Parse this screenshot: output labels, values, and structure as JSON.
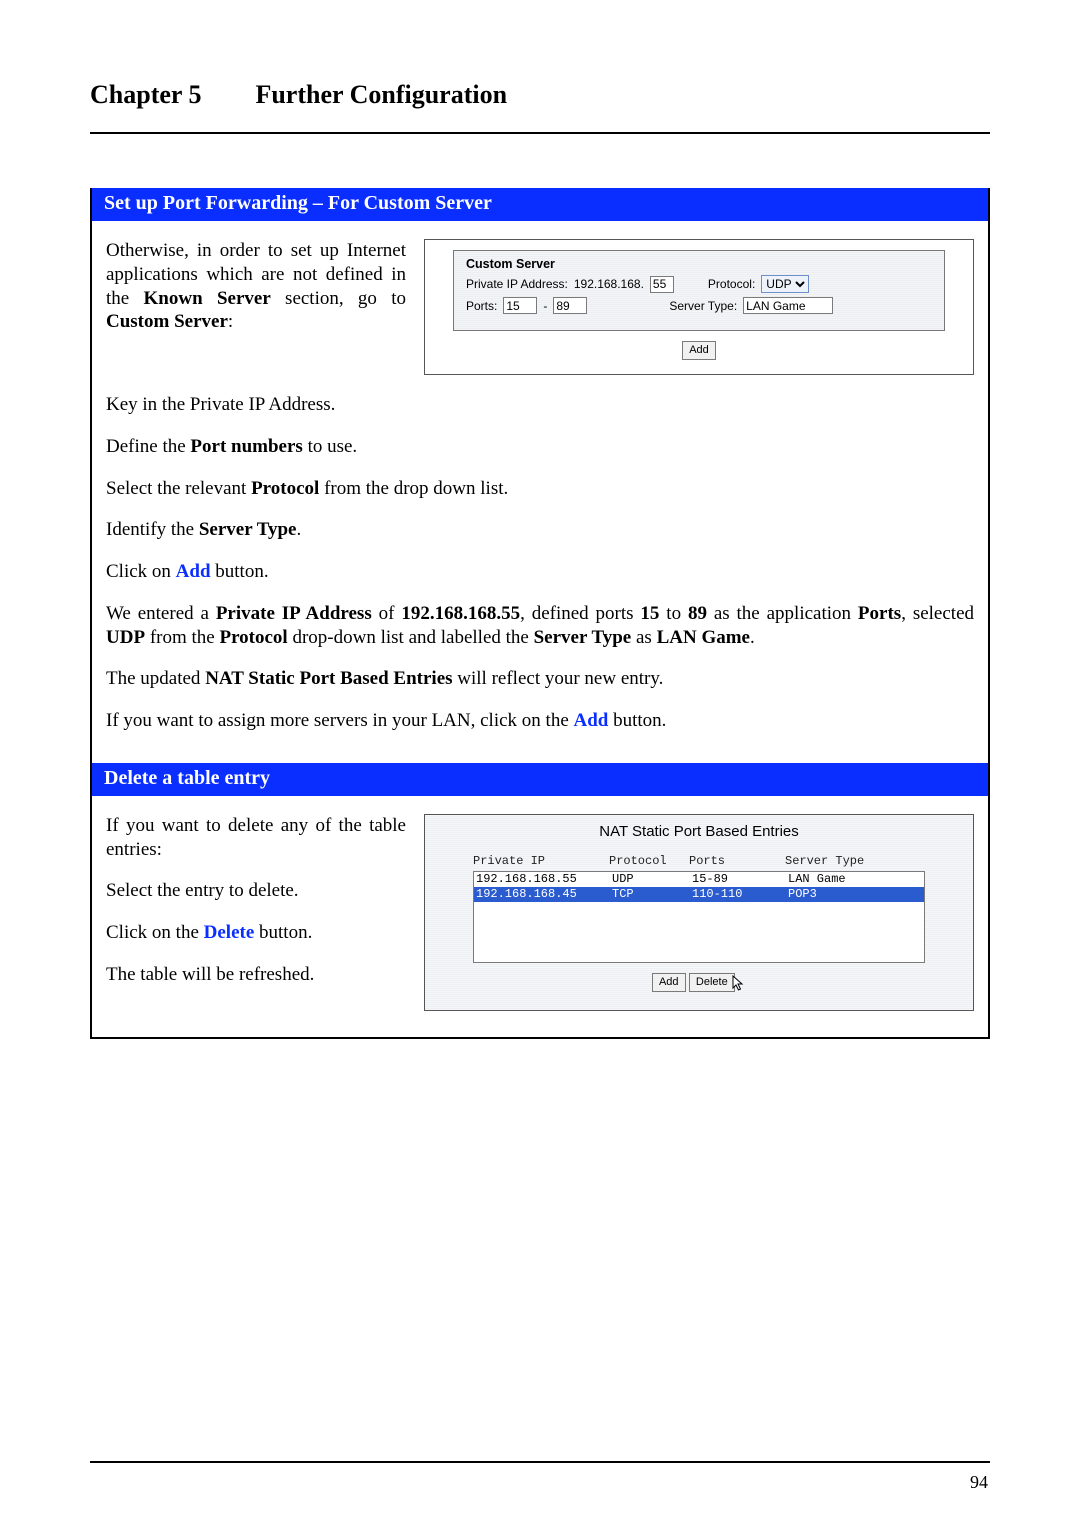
{
  "chapter": {
    "number": "Chapter 5",
    "title": "Further Configuration"
  },
  "page_number": "94",
  "section1": {
    "heading": "Set up Port Forwarding – For Custom Server",
    "p1_a": "Otherwise, in order to set up Internet applications which are not defined in the ",
    "p1_known": "Known Server",
    "p1_b": " section, go to ",
    "p1_custom": "Custom Server",
    "p1_c": ":",
    "p2": "Key in the Private IP Address.",
    "p3_a": "Define the ",
    "p3_b": "Port numbers",
    "p3_c": " to use.",
    "p4_a": "Select the relevant ",
    "p4_b": "Protocol",
    "p4_c": " from the drop down list.",
    "p5_a": "Identify the ",
    "p5_b": "Server Type",
    "p5_c": ".",
    "p6_a": "Click on ",
    "p6_add": "Add",
    "p6_b": " button.",
    "p7_full": "We entered a Private IP Address of 192.168.168.55, defined ports 15 to 89 as the application Ports, selected UDP from the Protocol drop-down list and labelled the Server Type as LAN Game.",
    "p8_a": "The updated ",
    "p8_b": "NAT Static Port Based Entries",
    "p8_c": " will reflect your new entry.",
    "p9_a": "If you want to assign more servers in your LAN, click on the ",
    "p9_add": "Add",
    "p9_b": " button."
  },
  "fig1": {
    "title": "Custom Server",
    "ip_label": "Private IP Address:",
    "ip_prefix": "192.168.168.",
    "ip_last": "55",
    "protocol_label": "Protocol:",
    "protocol_value": "UDP",
    "ports_label": "Ports:",
    "port_from": "15",
    "port_dash": "-",
    "port_to": "89",
    "server_type_label": "Server Type:",
    "server_type_value": "LAN Game",
    "add_btn": "Add"
  },
  "section2": {
    "heading": "Delete a table entry",
    "p1": "If you want to delete any of the table entries:",
    "p2": "Select the entry to delete.",
    "p3_a": "Click on the ",
    "p3_del": "Delete",
    "p3_b": " button.",
    "p4": "The table will be refreshed."
  },
  "fig2": {
    "title": "NAT Static Port Based Entries",
    "headers": {
      "ip": "Private IP",
      "protocol": "Protocol",
      "ports": "Ports",
      "type": "Server Type"
    },
    "rows": [
      {
        "ip": "192.168.168.55",
        "protocol": "UDP",
        "ports": "15-89",
        "type": "LAN Game",
        "selected": false
      },
      {
        "ip": "192.168.168.45",
        "protocol": "TCP",
        "ports": "110-110",
        "type": "POP3",
        "selected": true
      }
    ],
    "add_btn": "Add",
    "delete_btn": "Delete"
  }
}
